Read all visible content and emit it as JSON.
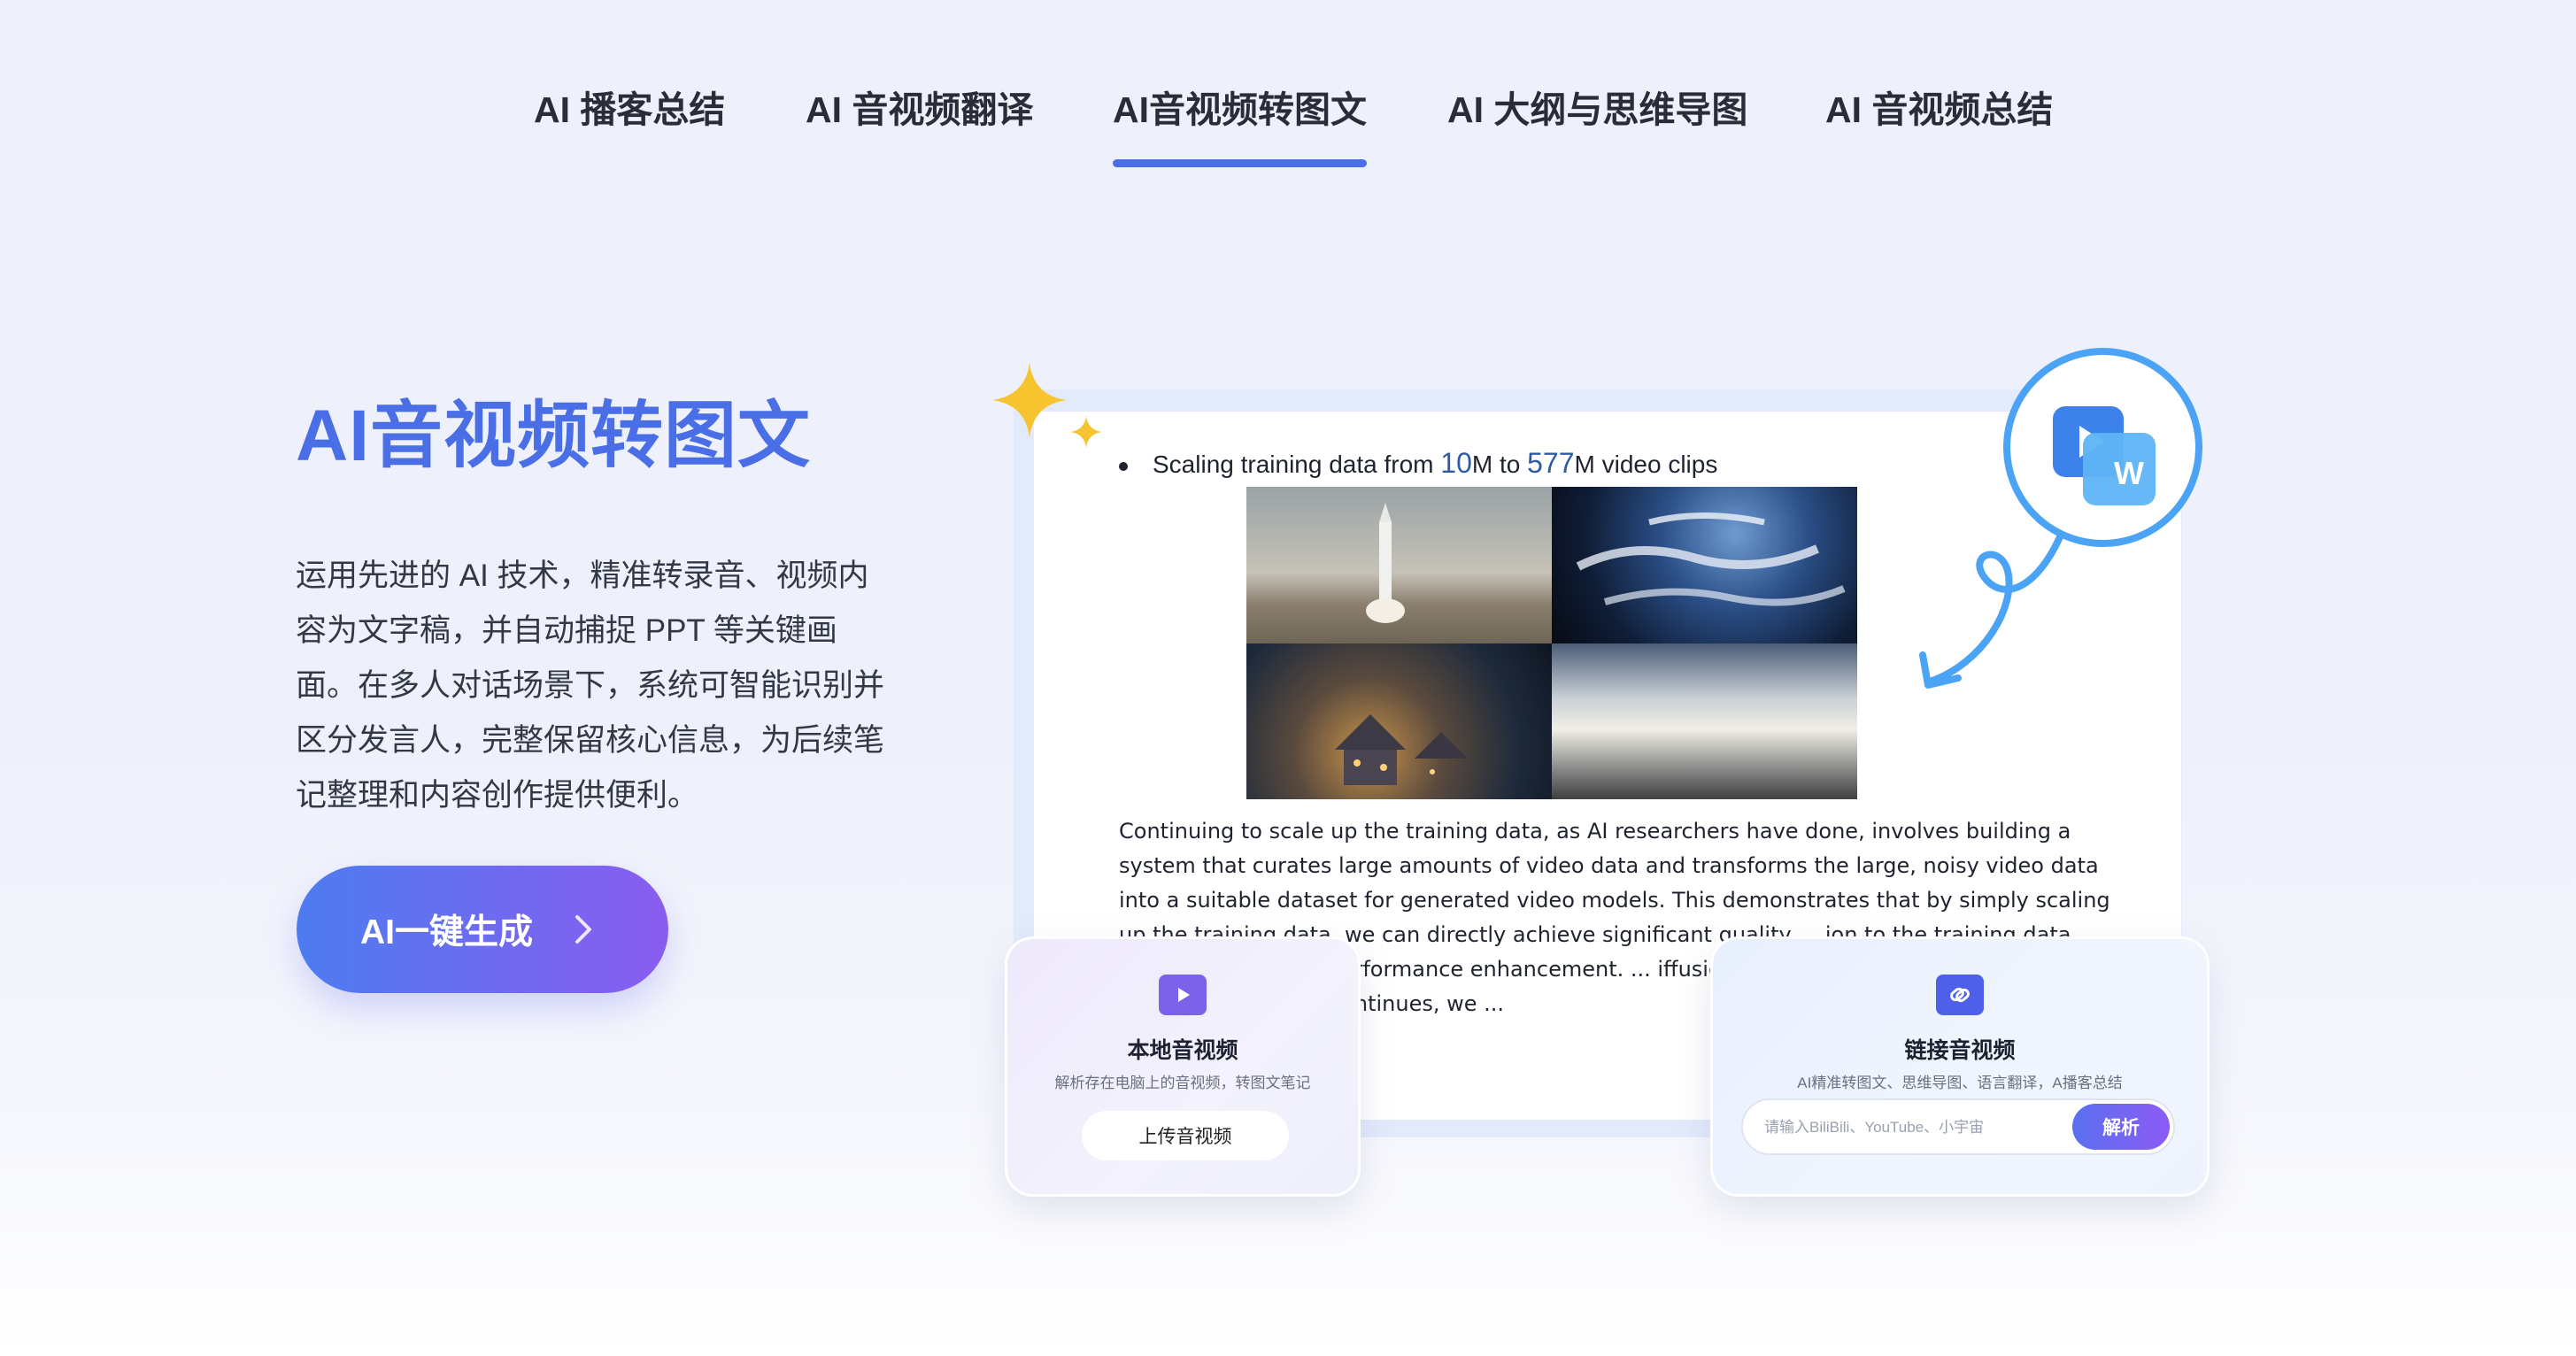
{
  "tabs": [
    {
      "label": "AI 播客总结"
    },
    {
      "label": "AI 音视频翻译"
    },
    {
      "label": "AI音视频转图文",
      "active": true
    },
    {
      "label": "AI 大纲与思维导图"
    },
    {
      "label": "AI 音视频总结"
    }
  ],
  "hero": {
    "title": "AI音视频转图文",
    "description": "运用先进的 AI 技术，精准转录音、视频内容为文字稿，并自动捕捉 PPT 等关键画面。在多人对话场景下，系统可智能识别并区分发言人，完整保留核心信息，为后续笔记整理和内容创作提供便利。",
    "cta_label": "AI一键生成",
    "cta_icon": "chevron-right-icon"
  },
  "document_preview": {
    "bullet_prefix": "Scaling training data from ",
    "bullet_num1": "10",
    "bullet_mid": "M to ",
    "bullet_num2": "577",
    "bullet_suffix": "M video clips",
    "images": [
      "rocket launch",
      "earth from space",
      "village at night",
      "sky and clouds"
    ],
    "paragraph": "Continuing to scale up the training data, as AI researchers have done, involves building a system that curates large amounts of video data and transforms the large, noisy video data into a suitable dataset for generated video models. This demonstrates that by simply scaling up the training data, we can directly achieve significant quality ... ion to the training data, another cr... role in performance enhancement. ... iffusion model can be effectively s... prompt, as training continues, we ..."
  },
  "badge": {
    "icon": "video-to-word-icon",
    "letter": "W"
  },
  "cards": {
    "local": {
      "icon": "play-icon",
      "title": "本地音视频",
      "subtitle": "解析存在电脑上的音视频，转图文笔记",
      "button_label": "上传音视频"
    },
    "link": {
      "icon": "link-icon",
      "title": "链接音视频",
      "subtitle": "AI精准转图文、思维导图、语言翻译，A播客总结",
      "input_placeholder": "请输入BiliBili、YouTube、小宇宙",
      "button_label": "解析"
    }
  },
  "colors": {
    "accent": "#4a6ee6",
    "cta_start": "#4d7cf0",
    "cta_end": "#8a5cf0",
    "badge_ring": "#4aa3f5",
    "star": "#f6c42f"
  }
}
